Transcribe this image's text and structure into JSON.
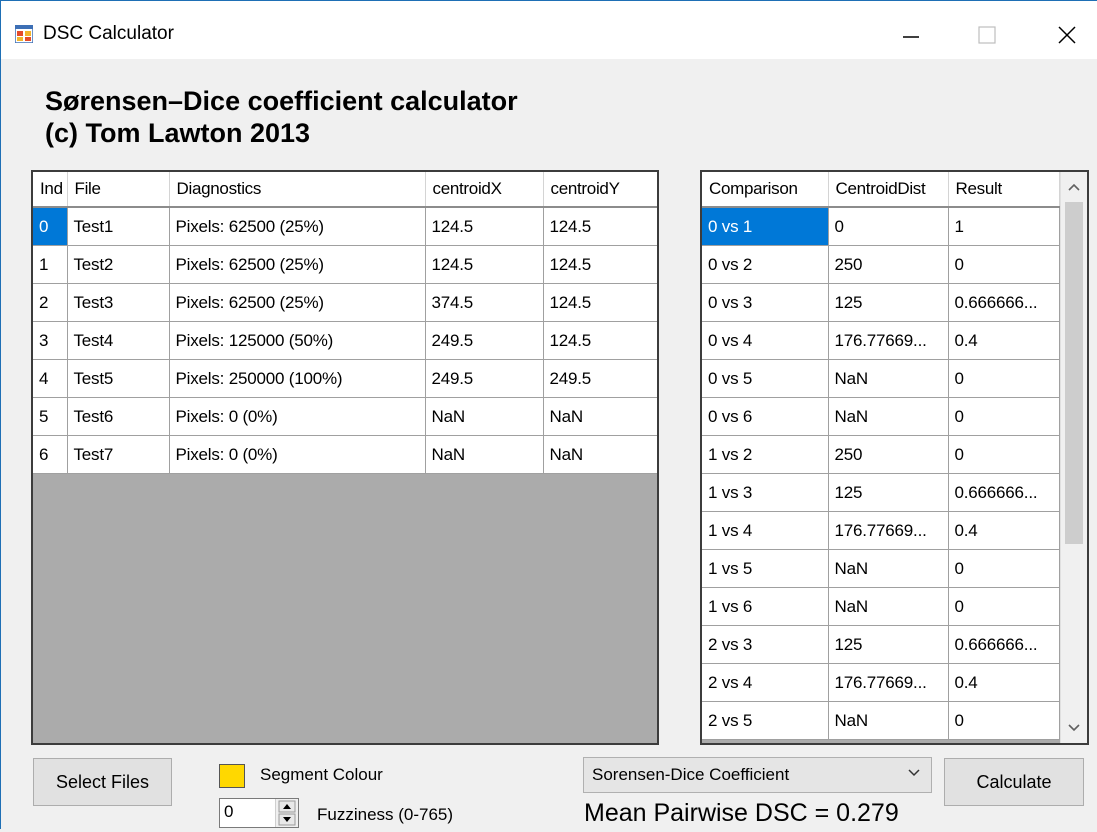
{
  "window": {
    "title": "DSC Calculator",
    "icons": {
      "app": "app-window-icon",
      "minimize": "minimize-icon",
      "maximize": "maximize-icon",
      "close": "close-icon"
    }
  },
  "heading": {
    "line1": "Sørensen–Dice coefficient calculator",
    "line2": "(c) Tom Lawton 2013"
  },
  "files_grid": {
    "columns": [
      "Ind",
      "File",
      "Diagnostics",
      "centroidX",
      "centroidY"
    ],
    "rows": [
      [
        "0",
        "Test1",
        "Pixels: 62500 (25%)",
        "124.5",
        "124.5"
      ],
      [
        "1",
        "Test2",
        "Pixels: 62500 (25%)",
        "124.5",
        "124.5"
      ],
      [
        "2",
        "Test3",
        "Pixels: 62500 (25%)",
        "374.5",
        "124.5"
      ],
      [
        "3",
        "Test4",
        "Pixels: 125000 (50%)",
        "249.5",
        "124.5"
      ],
      [
        "4",
        "Test5",
        "Pixels: 250000 (100%)",
        "249.5",
        "249.5"
      ],
      [
        "5",
        "Test6",
        "Pixels: 0 (0%)",
        "NaN",
        "NaN"
      ],
      [
        "6",
        "Test7",
        "Pixels: 0 (0%)",
        "NaN",
        "NaN"
      ]
    ],
    "selected_row": 0
  },
  "results_grid": {
    "columns": [
      "Comparison",
      "CentroidDist",
      "Result"
    ],
    "rows": [
      [
        "0 vs 1",
        "0",
        "1"
      ],
      [
        "0 vs 2",
        "250",
        "0"
      ],
      [
        "0 vs 3",
        "125",
        "0.666666..."
      ],
      [
        "0 vs 4",
        "176.77669...",
        "0.4"
      ],
      [
        "0 vs 5",
        "NaN",
        "0"
      ],
      [
        "0 vs 6",
        "NaN",
        "0"
      ],
      [
        "1 vs 2",
        "250",
        "0"
      ],
      [
        "1 vs 3",
        "125",
        "0.666666..."
      ],
      [
        "1 vs 4",
        "176.77669...",
        "0.4"
      ],
      [
        "1 vs 5",
        "NaN",
        "0"
      ],
      [
        "1 vs 6",
        "NaN",
        "0"
      ],
      [
        "2 vs 3",
        "125",
        "0.666666..."
      ],
      [
        "2 vs 4",
        "176.77669...",
        "0.4"
      ],
      [
        "2 vs 5",
        "NaN",
        "0"
      ]
    ],
    "selected_row": 0
  },
  "controls": {
    "select_files_label": "Select Files",
    "segment_colour_label": "Segment Colour",
    "segment_colour": "#ffd800",
    "fuzziness_value": "0",
    "fuzziness_label": "Fuzziness (0-765)",
    "method_selected": "Sorensen-Dice Coefficient",
    "calculate_label": "Calculate",
    "mean_text": "Mean Pairwise DSC = 0.279"
  },
  "colors": {
    "selection": "#0078d7",
    "grid_background": "#ababab"
  }
}
